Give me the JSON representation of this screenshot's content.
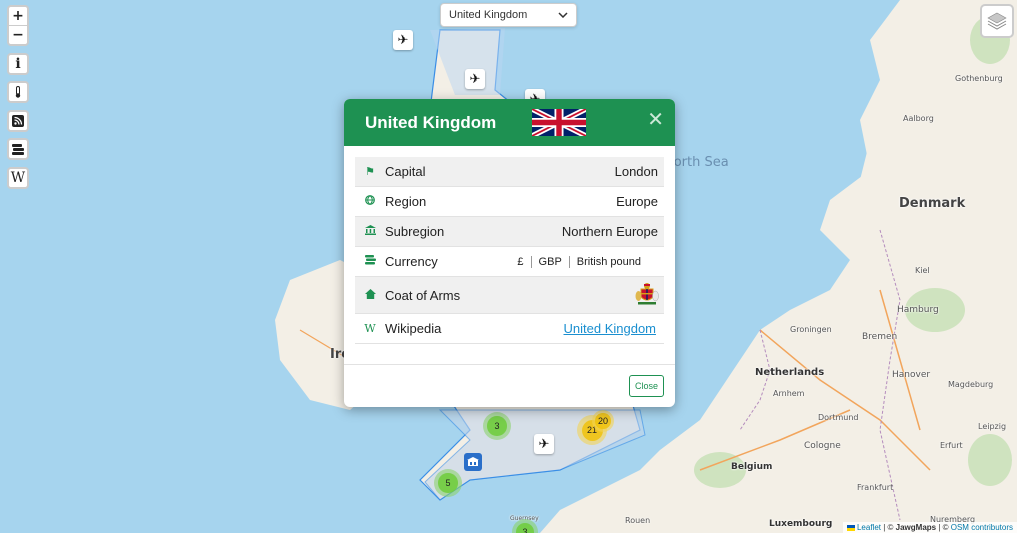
{
  "map": {
    "labels": {
      "north_sea": "North Sea",
      "ireland": "Ireland",
      "denmark": "Denmark",
      "netherlands": "Netherlands",
      "belgium": "Belgium",
      "luxembourg": "Luxembourg",
      "aalborg": "Aalborg",
      "gothenburg": "Gothenburg",
      "kiel": "Kiel",
      "hamburg": "Hamburg",
      "groningen": "Groningen",
      "bremen": "Bremen",
      "hanover": "Hanover",
      "magdeburg": "Magdeburg",
      "arnhem": "Arnhem",
      "dortmund": "Dortmund",
      "cologne": "Cologne",
      "erfurt": "Erfurt",
      "leipzig": "Leipzig",
      "frankfurt": "Frankfurt",
      "nuremberg": "Nuremberg",
      "rouen": "Rouen",
      "guernsey": "Guernsey"
    },
    "clusters": [
      "3",
      "21",
      "20",
      "5",
      "3"
    ],
    "attribution": {
      "leaflet": "Leaflet",
      "sep1": " | © ",
      "jawg": "JawgMaps",
      "sep2": " | © ",
      "osm": "OSM contributors"
    }
  },
  "controls": {
    "zoom_in": "+",
    "zoom_out": "−",
    "info": "i",
    "wiki": "W"
  },
  "country_select": {
    "selected": "United Kingdom"
  },
  "modal": {
    "title": "United Kingdom",
    "rows": {
      "capital": {
        "label": "Capital",
        "value": "London"
      },
      "region": {
        "label": "Region",
        "value": "Europe"
      },
      "subregion": {
        "label": "Subregion",
        "value": "Northern Europe"
      },
      "currency": {
        "label": "Currency",
        "symbol": "£",
        "code": "GBP",
        "name": "British pound"
      },
      "coat_of_arms": {
        "label": "Coat of Arms"
      },
      "wikipedia": {
        "label": "Wikipedia",
        "link": "United Kingdom"
      }
    },
    "close_label": "Close"
  }
}
